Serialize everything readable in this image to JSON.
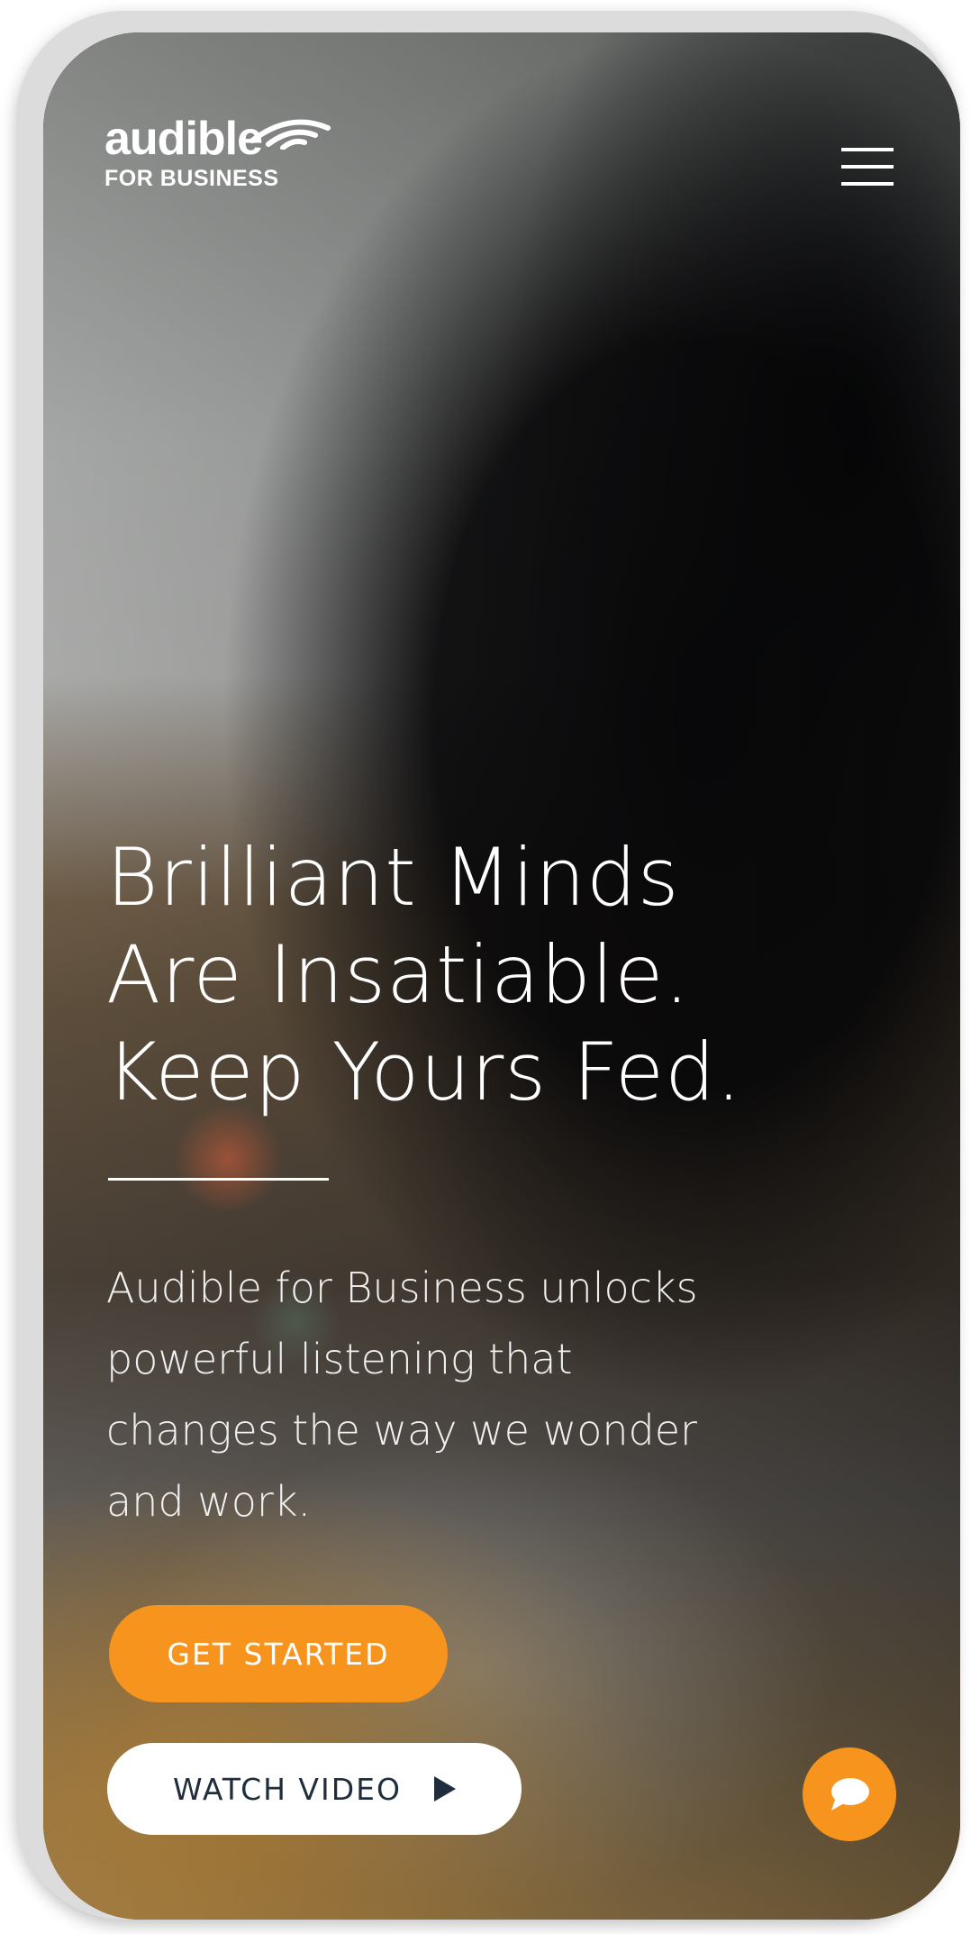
{
  "brand": {
    "name": "audible",
    "tagline": "FOR BUSINESS"
  },
  "hero": {
    "headline_lines": [
      "Brilliant Minds",
      "Are Insatiable.",
      "Keep Yours Fed."
    ],
    "description_lines": [
      "Audible for Business unlocks",
      "powerful listening that",
      "changes the way we wonder",
      "and work."
    ]
  },
  "buttons": {
    "get_started": "GET STARTED",
    "watch_video": "WATCH VIDEO"
  },
  "icons": {
    "menu": "hamburger-menu-icon",
    "play": "play-icon",
    "chat": "chat-bubble-icon",
    "logo_waves": "audible-waves-icon"
  },
  "colors": {
    "accent": "#f7941d",
    "button_text_dark": "#1f2d3d",
    "text": "#ffffff"
  }
}
